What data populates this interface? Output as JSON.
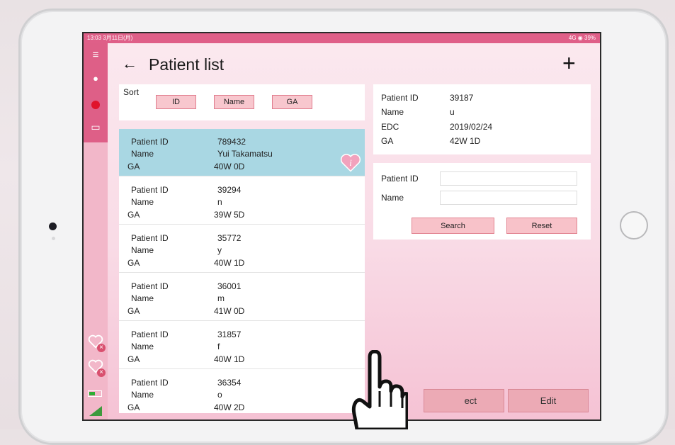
{
  "status_bar": {
    "left": "13:03 3月11日(月)",
    "right": "4G ◉ 39%"
  },
  "header": {
    "title": "Patient list"
  },
  "sort": {
    "label": "Sort",
    "buttons": [
      "ID",
      "Name",
      "GA"
    ]
  },
  "labels": {
    "patient_id": "Patient ID",
    "name": "Name",
    "ga": "GA",
    "edc": "EDC"
  },
  "patients": [
    {
      "id": "789432",
      "name": "Yui Takamatsu",
      "ga": "40W 0D"
    },
    {
      "id": "39294",
      "name": "n",
      "ga": "39W 5D"
    },
    {
      "id": "35772",
      "name": "y",
      "ga": "40W 1D"
    },
    {
      "id": "36001",
      "name": "m",
      "ga": "41W 0D"
    },
    {
      "id": "31857",
      "name": "f",
      "ga": "40W 1D"
    },
    {
      "id": "36354",
      "name": "o",
      "ga": "40W 2D"
    }
  ],
  "detail": {
    "id": "39187",
    "name": "u",
    "edc": "2019/02/24",
    "ga": "42W 1D"
  },
  "search": {
    "id_label": "Patient ID",
    "name_label": "Name",
    "id_value": "",
    "name_value": "",
    "search_btn": "Search",
    "reset_btn": "Reset"
  },
  "footer": {
    "select_btn": "ect",
    "edit_btn": "Edit"
  },
  "colors": {
    "accent": "#de5f87",
    "selected_row": "#a9d7e3",
    "button": "#f8c7ce"
  }
}
